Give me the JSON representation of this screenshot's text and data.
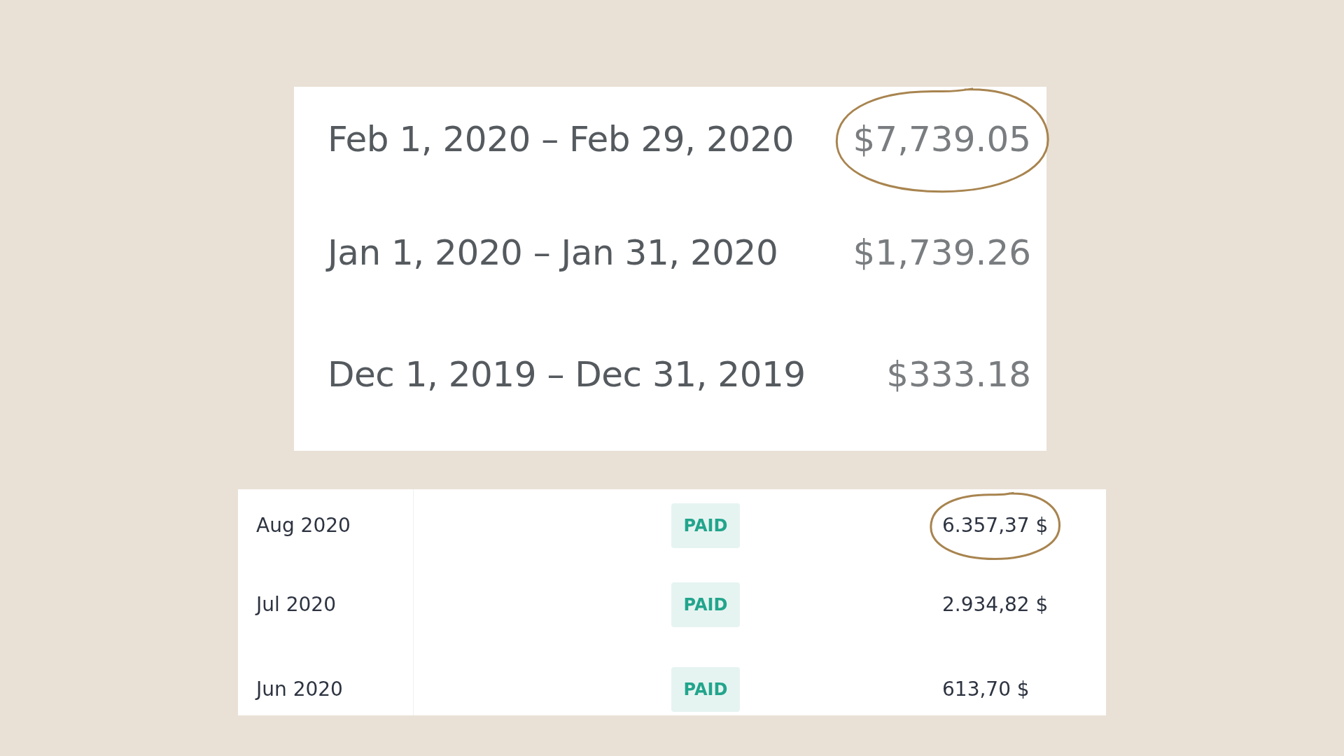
{
  "invoice_summary": {
    "rows": [
      {
        "period": "Feb 1, 2020 – Feb 29, 2020",
        "amount": "$7,739.05",
        "circled": true
      },
      {
        "period": "Jan 1, 2020 – Jan 31, 2020",
        "amount": "$1,739.26",
        "circled": false
      },
      {
        "period": "Dec 1, 2019 – Dec 31, 2019",
        "amount": "$333.18",
        "circled": false
      }
    ]
  },
  "billing_history": {
    "rows": [
      {
        "month": "Aug 2020",
        "status": "PAID",
        "amount": "6.357,37 $",
        "circled": true
      },
      {
        "month": "Jul 2020",
        "status": "PAID",
        "amount": "2.934,82 $",
        "circled": false
      },
      {
        "month": "Jun 2020",
        "status": "PAID",
        "amount": "613,70 $",
        "circled": false
      }
    ]
  }
}
